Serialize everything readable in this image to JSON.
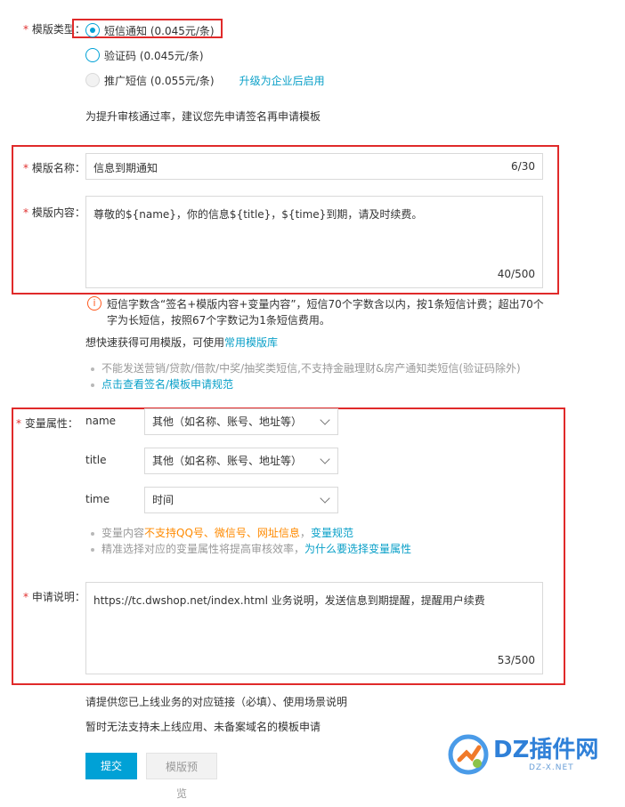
{
  "template_type": {
    "label": "模版类型：",
    "options": [
      {
        "label": "短信通知 (0.045元/条)",
        "selected": true,
        "disabled": false
      },
      {
        "label": "验证码 (0.045元/条)",
        "selected": false,
        "disabled": false
      },
      {
        "label": "推广短信 (0.055元/条)",
        "selected": false,
        "disabled": true
      }
    ],
    "upgrade_link": "升级为企业后启用",
    "hint": "为提升审核通过率，建议您先申请签名再申请模板"
  },
  "template_name": {
    "label": "模版名称：",
    "value": "信息到期通知",
    "counter": "6/30"
  },
  "template_content": {
    "label": "模版内容：",
    "value": "尊敬的${name}，你的信息${title}，${time}到期，请及时续费。",
    "counter": "40/500",
    "info_line1": "短信字数含“签名+模版内容+变量内容”，短信70个字数含以内，按1条短信计费；超出70个",
    "info_line2": "字为长短信，按照67个字数记为1条短信费用。",
    "quick_text": "想快速获得可用模版，可使用",
    "quick_link": "常用模版库",
    "rule1": "不能发送营销/贷款/借款/中奖/抽奖类短信,不支持金融理财&房产通知类短信(验证码除外)",
    "rule2_link": "点击查看签名/模板申请规范"
  },
  "variables": {
    "label": "变量属性：",
    "items": [
      {
        "name": "name",
        "value": "其他（如名称、账号、地址等）"
      },
      {
        "name": "title",
        "value": "其他（如名称、账号、地址等）"
      },
      {
        "name": "time",
        "value": "时间"
      }
    ],
    "note1_prefix": "变量内容",
    "note1_warning": "不支持QQ号、微信号、网址信息",
    "note1_sep": "，",
    "note1_link": "变量规范",
    "note2_text": "精准选择对应的变量属性将提高审核效率，",
    "note2_link": "为什么要选择变量属性"
  },
  "application": {
    "label": "申请说明：",
    "value": "https://tc.dwshop.net/index.html 业务说明，发送信息到期提醒，提醒用户续费",
    "counter": "53/500",
    "hint1": "请提供您已上线业务的对应链接（必填）、使用场景说明",
    "hint2": "暂时无法支持未上线应用、未备案域名的模板申请"
  },
  "buttons": {
    "submit": "提交",
    "preview": "模版预览"
  },
  "watermark": {
    "brand": "DZ插件网",
    "sub": "DZ-X.NET"
  },
  "colors": {
    "accent": "#00a1d6",
    "link": "#0aa0c8",
    "warning": "#ff8a00",
    "required": "#e0302f",
    "highlight_box": "#e02a2a"
  }
}
